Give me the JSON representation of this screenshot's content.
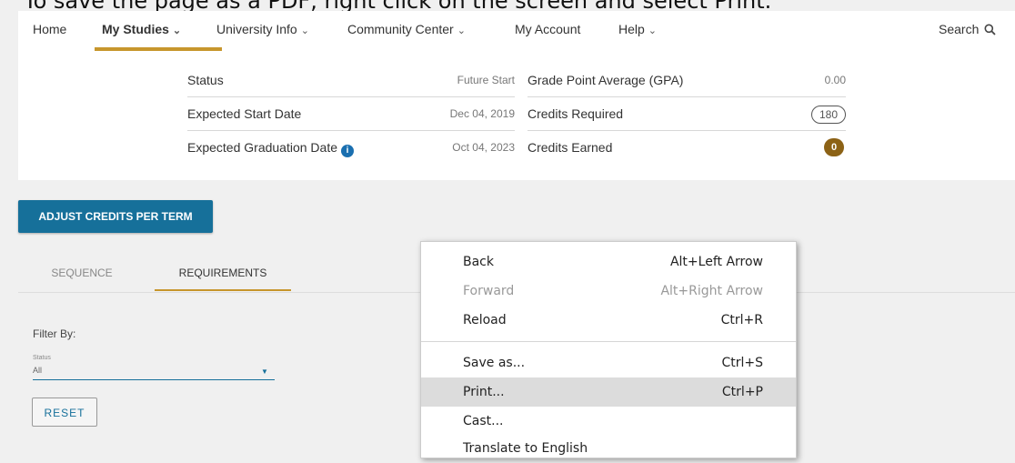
{
  "instruction": "To save the page as a PDF, right click on the screen and select Print.",
  "nav": {
    "home": "Home",
    "my_studies": "My Studies",
    "university_info": "University Info",
    "community_center": "Community Center",
    "my_account": "My Account",
    "help": "Help",
    "search": "Search",
    "chevron_icon": "chevron-down-icon",
    "search_icon": "search-icon"
  },
  "summary": {
    "left": [
      {
        "label": "Status",
        "value": "Future Start"
      },
      {
        "label": "Expected Start Date",
        "value": "Dec 04, 2019"
      },
      {
        "label": "Expected Graduation Date",
        "value": "Oct 04, 2023",
        "info_icon": "i"
      }
    ],
    "right": [
      {
        "label": "Grade Point Average (GPA)",
        "value": "0.00"
      },
      {
        "label": "Credits Required",
        "value": "180"
      },
      {
        "label": "Credits Earned",
        "value": "0"
      }
    ]
  },
  "adjust_button": "ADJUST CREDITS PER TERM",
  "tabs": {
    "sequence": "SEQUENCE",
    "requirements": "REQUIREMENTS"
  },
  "filter": {
    "label": "Filter By:",
    "status_label": "Status",
    "status_value": "All",
    "reset": "RESET"
  },
  "context_menu": {
    "items": [
      {
        "label": "Back",
        "shortcut": "Alt+Left Arrow"
      },
      {
        "label": "Forward",
        "shortcut": "Alt+Right Arrow"
      },
      {
        "label": "Reload",
        "shortcut": "Ctrl+R"
      },
      {
        "label": "Save as...",
        "shortcut": "Ctrl+S"
      },
      {
        "label": "Print...",
        "shortcut": "Ctrl+P"
      },
      {
        "label": "Cast...",
        "shortcut": ""
      },
      {
        "label": "Translate to English",
        "shortcut": ""
      }
    ]
  },
  "colors": {
    "accent_gold": "#c7962c",
    "primary_blue": "#16709a",
    "badge_brown": "#8c6216"
  }
}
